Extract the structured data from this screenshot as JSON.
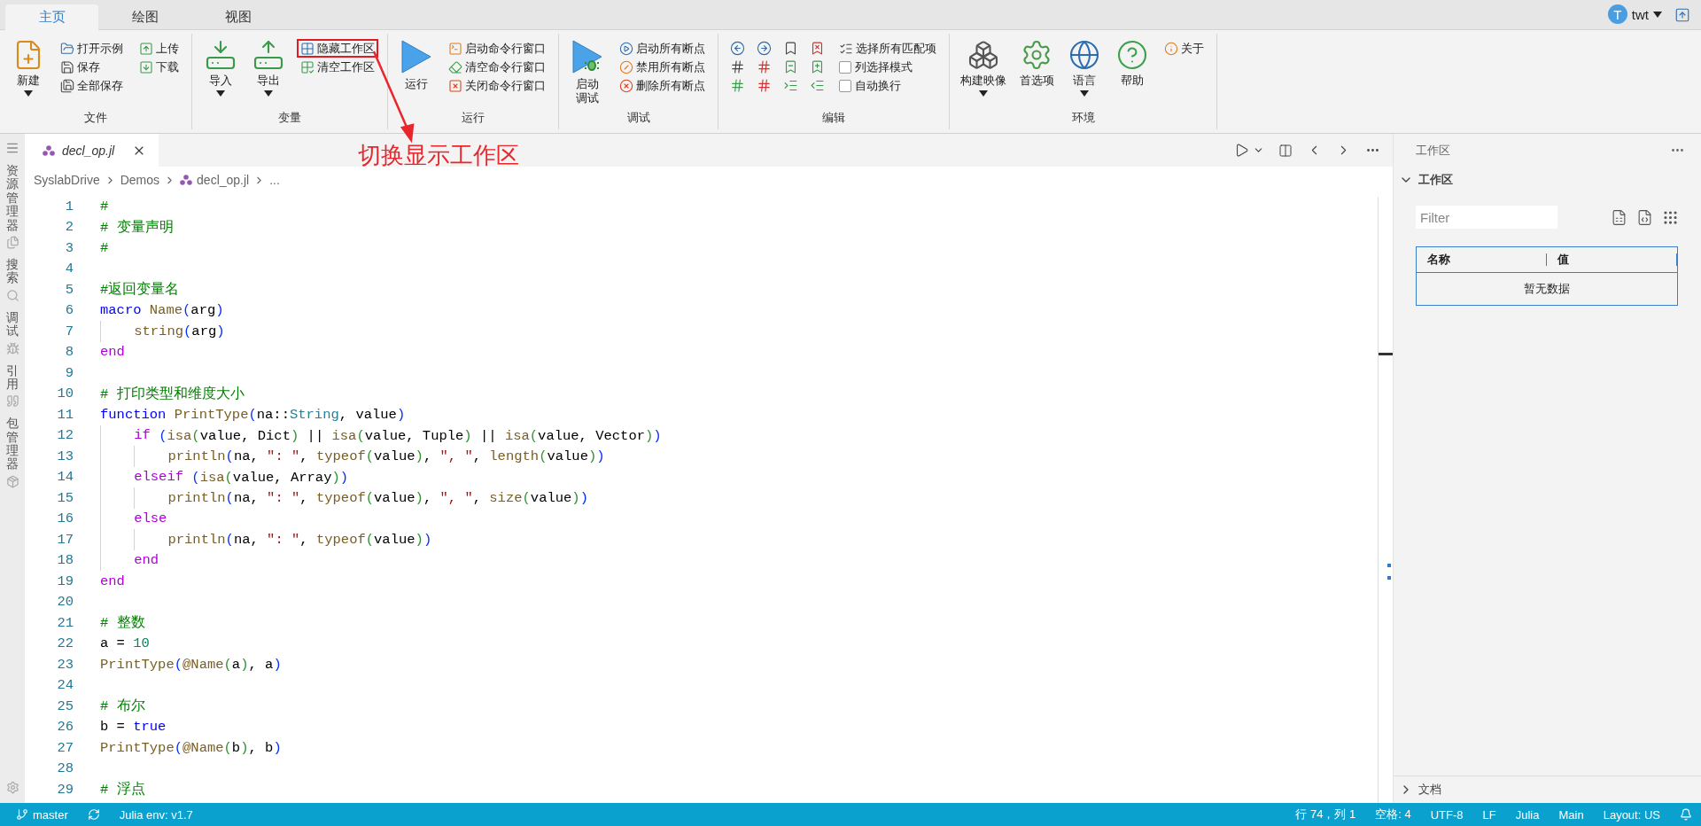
{
  "ribbon": {
    "tabs": [
      {
        "label": "主页",
        "selected": true
      },
      {
        "label": "绘图",
        "selected": false
      },
      {
        "label": "视图",
        "selected": false
      }
    ],
    "user": {
      "initial": "T",
      "name": "twt"
    },
    "groups": [
      {
        "label": "文件",
        "items": [
          {
            "kind": "large",
            "label": "新建",
            "dropdown": true
          },
          {
            "kind": "small",
            "label": "打开示例"
          },
          {
            "kind": "small",
            "label": "保存"
          },
          {
            "kind": "small",
            "label": "全部保存"
          },
          {
            "kind": "small",
            "label": "上传"
          },
          {
            "kind": "small",
            "label": "下载"
          }
        ]
      },
      {
        "label": "变量",
        "items": [
          {
            "kind": "large",
            "label": "导入",
            "dropdown": true
          },
          {
            "kind": "large",
            "label": "导出",
            "dropdown": true
          },
          {
            "kind": "small",
            "label": "隐藏工作区",
            "highlighted": true
          },
          {
            "kind": "small",
            "label": "清空工作区"
          }
        ]
      },
      {
        "label": "运行",
        "items": [
          {
            "kind": "large",
            "label": "运行"
          },
          {
            "kind": "small",
            "label": "启动命令行窗口"
          },
          {
            "kind": "small",
            "label": "清空命令行窗口"
          },
          {
            "kind": "small",
            "label": "关闭命令行窗口"
          }
        ]
      },
      {
        "label": "调试",
        "items": [
          {
            "kind": "large",
            "lines": [
              "启动",
              "调试"
            ]
          },
          {
            "kind": "small",
            "label": "启动所有断点"
          },
          {
            "kind": "small",
            "label": "禁用所有断点"
          },
          {
            "kind": "small",
            "label": "删除所有断点"
          }
        ]
      },
      {
        "label": "编辑",
        "items": [
          {
            "kind": "icon_grid"
          },
          {
            "kind": "small",
            "label": "选择所有匹配项"
          },
          {
            "kind": "check",
            "label": "列选择模式",
            "checked": false
          },
          {
            "kind": "check",
            "label": "自动换行",
            "checked": false
          }
        ]
      },
      {
        "label": "环境",
        "items": [
          {
            "kind": "large",
            "label": "构建映像",
            "dropdown": true
          },
          {
            "kind": "large",
            "label": "首选项"
          },
          {
            "kind": "large",
            "label": "语言",
            "dropdown": true
          },
          {
            "kind": "large",
            "label": "帮助"
          },
          {
            "kind": "small",
            "label": "关于"
          }
        ]
      }
    ]
  },
  "annotation": {
    "text": "切换显示工作区"
  },
  "activity_bar": {
    "items": [
      {
        "label": "资源管理器"
      },
      {
        "label": "搜索"
      },
      {
        "label": "调试"
      },
      {
        "label": "引用"
      },
      {
        "label": "包管理器"
      }
    ]
  },
  "editor": {
    "tabs": [
      {
        "label": "decl_op.jl",
        "selected": true
      }
    ],
    "breadcrumbs": [
      "SyslabDrive",
      "Demos",
      "decl_op.jl",
      "..."
    ],
    "lines": [
      {
        "number": "1",
        "tokens": [
          {
            "kind": "comment",
            "text": "#"
          }
        ]
      },
      {
        "number": "2",
        "tokens": [
          {
            "kind": "comment",
            "text": "# 变量声明"
          }
        ]
      },
      {
        "number": "3",
        "tokens": [
          {
            "kind": "comment",
            "text": "#"
          }
        ]
      },
      {
        "number": "4"
      },
      {
        "number": "5",
        "tokens": [
          {
            "kind": "comment",
            "text": "#返回变量名"
          }
        ]
      },
      {
        "number": "6",
        "tokens": [
          {
            "kind": "keyword",
            "text": "macro"
          },
          {
            "kind": "function",
            "text": " Name"
          },
          {
            "kind": "bracket1",
            "text": "("
          },
          {
            "kind": "plain",
            "text": "arg"
          },
          {
            "kind": "bracket1",
            "text": ")"
          }
        ]
      },
      {
        "number": "7",
        "tokens": [
          {
            "kind": "function",
            "text": "    string"
          },
          {
            "kind": "bracket1",
            "text": "("
          },
          {
            "kind": "plain",
            "text": "arg"
          },
          {
            "kind": "bracket1",
            "text": ")"
          }
        ]
      },
      {
        "number": "8",
        "tokens": [
          {
            "kind": "control",
            "text": "end"
          }
        ]
      },
      {
        "number": "9"
      },
      {
        "number": "10",
        "tokens": [
          {
            "kind": "comment",
            "text": "# 打印类型和维度大小"
          }
        ]
      },
      {
        "number": "11",
        "tokens": [
          {
            "kind": "keyword",
            "text": "function"
          },
          {
            "kind": "function",
            "text": " PrintType"
          },
          {
            "kind": "bracket1",
            "text": "("
          },
          {
            "kind": "plain",
            "text": "na::"
          },
          {
            "kind": "type",
            "text": "String"
          },
          {
            "kind": "plain",
            "text": ", value"
          },
          {
            "kind": "bracket1",
            "text": ")"
          }
        ]
      },
      {
        "number": "12",
        "tokens": [
          {
            "kind": "control",
            "text": "    if"
          },
          {
            "kind": "bracket1",
            "text": " ("
          },
          {
            "kind": "function",
            "text": "isa"
          },
          {
            "kind": "bracket2",
            "text": "("
          },
          {
            "kind": "plain",
            "text": "value, Dict"
          },
          {
            "kind": "bracket2",
            "text": ")"
          },
          {
            "kind": "plain",
            "text": " || "
          },
          {
            "kind": "function",
            "text": "isa"
          },
          {
            "kind": "bracket2",
            "text": "("
          },
          {
            "kind": "plain",
            "text": "value, Tuple"
          },
          {
            "kind": "bracket2",
            "text": ")"
          },
          {
            "kind": "plain",
            "text": " || "
          },
          {
            "kind": "function",
            "text": "isa"
          },
          {
            "kind": "bracket2",
            "text": "("
          },
          {
            "kind": "plain",
            "text": "value, Vector"
          },
          {
            "kind": "bracket2",
            "text": ")"
          },
          {
            "kind": "bracket1",
            "text": ")"
          }
        ]
      },
      {
        "number": "13",
        "tokens": [
          {
            "kind": "function",
            "text": "        println"
          },
          {
            "kind": "bracket1",
            "text": "("
          },
          {
            "kind": "plain",
            "text": "na, "
          },
          {
            "kind": "string",
            "text": "\": \""
          },
          {
            "kind": "plain",
            "text": ", "
          },
          {
            "kind": "function",
            "text": "typeof"
          },
          {
            "kind": "bracket2",
            "text": "("
          },
          {
            "kind": "plain",
            "text": "value"
          },
          {
            "kind": "bracket2",
            "text": ")"
          },
          {
            "kind": "plain",
            "text": ", "
          },
          {
            "kind": "string",
            "text": "\", \""
          },
          {
            "kind": "plain",
            "text": ", "
          },
          {
            "kind": "function",
            "text": "length"
          },
          {
            "kind": "bracket2",
            "text": "("
          },
          {
            "kind": "plain",
            "text": "value"
          },
          {
            "kind": "bracket2",
            "text": ")"
          },
          {
            "kind": "bracket1",
            "text": ")"
          }
        ]
      },
      {
        "number": "14",
        "tokens": [
          {
            "kind": "control",
            "text": "    elseif"
          },
          {
            "kind": "bracket1",
            "text": " ("
          },
          {
            "kind": "function",
            "text": "isa"
          },
          {
            "kind": "bracket2",
            "text": "("
          },
          {
            "kind": "plain",
            "text": "value, Array"
          },
          {
            "kind": "bracket2",
            "text": ")"
          },
          {
            "kind": "bracket1",
            "text": ")"
          }
        ]
      },
      {
        "number": "15",
        "tokens": [
          {
            "kind": "function",
            "text": "        println"
          },
          {
            "kind": "bracket1",
            "text": "("
          },
          {
            "kind": "plain",
            "text": "na, "
          },
          {
            "kind": "string",
            "text": "\": \""
          },
          {
            "kind": "plain",
            "text": ", "
          },
          {
            "kind": "function",
            "text": "typeof"
          },
          {
            "kind": "bracket2",
            "text": "("
          },
          {
            "kind": "plain",
            "text": "value"
          },
          {
            "kind": "bracket2",
            "text": ")"
          },
          {
            "kind": "plain",
            "text": ", "
          },
          {
            "kind": "string",
            "text": "\", \""
          },
          {
            "kind": "plain",
            "text": ", "
          },
          {
            "kind": "function",
            "text": "size"
          },
          {
            "kind": "bracket2",
            "text": "("
          },
          {
            "kind": "plain",
            "text": "value"
          },
          {
            "kind": "bracket2",
            "text": ")"
          },
          {
            "kind": "bracket1",
            "text": ")"
          }
        ]
      },
      {
        "number": "16",
        "tokens": [
          {
            "kind": "control",
            "text": "    else"
          }
        ]
      },
      {
        "number": "17",
        "tokens": [
          {
            "kind": "function",
            "text": "        println"
          },
          {
            "kind": "bracket1",
            "text": "("
          },
          {
            "kind": "plain",
            "text": "na, "
          },
          {
            "kind": "string",
            "text": "\": \""
          },
          {
            "kind": "plain",
            "text": ", "
          },
          {
            "kind": "function",
            "text": "typeof"
          },
          {
            "kind": "bracket2",
            "text": "("
          },
          {
            "kind": "plain",
            "text": "value"
          },
          {
            "kind": "bracket2",
            "text": ")"
          },
          {
            "kind": "bracket1",
            "text": ")"
          }
        ]
      },
      {
        "number": "18",
        "tokens": [
          {
            "kind": "control",
            "text": "    end"
          }
        ]
      },
      {
        "number": "19",
        "tokens": [
          {
            "kind": "control",
            "text": "end"
          }
        ]
      },
      {
        "number": "20"
      },
      {
        "number": "21",
        "tokens": [
          {
            "kind": "comment",
            "text": "# 整数"
          }
        ]
      },
      {
        "number": "22",
        "tokens": [
          {
            "kind": "plain",
            "text": "a = "
          },
          {
            "kind": "number",
            "text": "10"
          }
        ]
      },
      {
        "number": "23",
        "tokens": [
          {
            "kind": "function",
            "text": "PrintType"
          },
          {
            "kind": "bracket1",
            "text": "("
          },
          {
            "kind": "function",
            "text": "@Name"
          },
          {
            "kind": "bracket2",
            "text": "("
          },
          {
            "kind": "plain",
            "text": "a"
          },
          {
            "kind": "bracket2",
            "text": ")"
          },
          {
            "kind": "plain",
            "text": ", a"
          },
          {
            "kind": "bracket1",
            "text": ")"
          }
        ]
      },
      {
        "number": "24"
      },
      {
        "number": "25",
        "tokens": [
          {
            "kind": "comment",
            "text": "# 布尔"
          }
        ]
      },
      {
        "number": "26",
        "tokens": [
          {
            "kind": "plain",
            "text": "b = "
          },
          {
            "kind": "keyword",
            "text": "true"
          }
        ]
      },
      {
        "number": "27",
        "tokens": [
          {
            "kind": "function",
            "text": "PrintType"
          },
          {
            "kind": "bracket1",
            "text": "("
          },
          {
            "kind": "function",
            "text": "@Name"
          },
          {
            "kind": "bracket2",
            "text": "("
          },
          {
            "kind": "plain",
            "text": "b"
          },
          {
            "kind": "bracket2",
            "text": ")"
          },
          {
            "kind": "plain",
            "text": ", b"
          },
          {
            "kind": "bracket1",
            "text": ")"
          }
        ]
      },
      {
        "number": "28"
      },
      {
        "number": "29",
        "tokens": [
          {
            "kind": "comment",
            "text": "# 浮点"
          }
        ]
      }
    ]
  },
  "workspace_panel": {
    "title": "工作区",
    "section": {
      "title": "工作区",
      "expanded": true
    },
    "filter": {
      "placeholder": "Filter"
    },
    "columns": [
      "名称",
      "值"
    ],
    "empty_text": "暂无数据",
    "docs_section": {
      "title": "文档",
      "expanded": false
    }
  },
  "status_bar": {
    "left": [
      {
        "kind": "branch",
        "text": "master"
      },
      {
        "kind": "sync"
      },
      {
        "kind": "text",
        "text": "Julia env: v1.7"
      }
    ],
    "right": [
      {
        "kind": "text",
        "text": "行 74，列 1"
      },
      {
        "kind": "text",
        "text": "空格: 4"
      },
      {
        "kind": "text",
        "text": "UTF-8"
      },
      {
        "kind": "text",
        "text": "LF"
      },
      {
        "kind": "text",
        "text": "Julia"
      },
      {
        "kind": "text",
        "text": "Main"
      },
      {
        "kind": "text",
        "text": "Layout: US"
      },
      {
        "kind": "bell"
      }
    ]
  }
}
